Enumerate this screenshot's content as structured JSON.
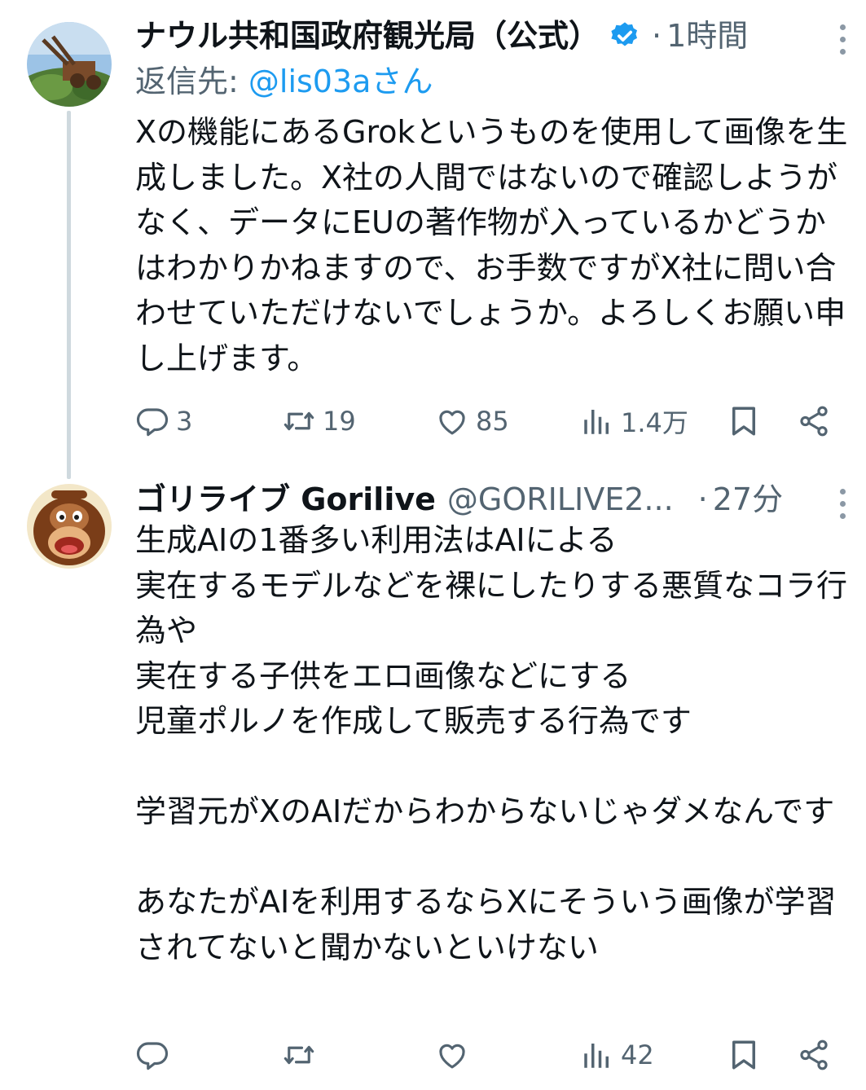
{
  "tweets": [
    {
      "display_name": "ナウル共和国政府観光局（公式）",
      "verified": true,
      "separator": "·",
      "time": "1時間",
      "reply_prefix": "返信先: ",
      "reply_to": "@lis03aさん",
      "text": "Xの機能にあるGrokというものを使用して画像を生成しました。X社の人間ではないので確認しようがなく、データにEUの著作物が入っているかどうかはわかりかねますので、お手数ですがX社に問い合わせていただけないでしょうか。よろしくお願い申し上げます。",
      "actions": {
        "replies": "3",
        "reposts": "19",
        "likes": "85",
        "views": "1.4万"
      }
    },
    {
      "display_name": "ゴリライブ Gorilive",
      "handle": "@GORILIVE2...",
      "separator": "·",
      "time": "27分",
      "text": "生成AIの1番多い利用法はAIによる\n実在するモデルなどを裸にしたりする悪質なコラ行為や\n実在する子供をエロ画像などにする\n児童ポルノを作成して販売する行為です\n\n学習元がXのAIだからわからないじゃダメなんです\n\nあなたがAIを利用するならXにそういう画像が学習されてないと聞かないといけない",
      "actions": {
        "replies": "",
        "reposts": "",
        "likes": "",
        "views": "42"
      }
    }
  ],
  "icons": [
    "verified-badge-icon",
    "more-icon",
    "reply-icon",
    "repost-icon",
    "like-icon",
    "views-icon",
    "bookmark-icon",
    "share-icon"
  ],
  "colors": {
    "accent": "#1d9bf0",
    "secondary_text": "#536471",
    "thread_line": "#cfd9de"
  }
}
